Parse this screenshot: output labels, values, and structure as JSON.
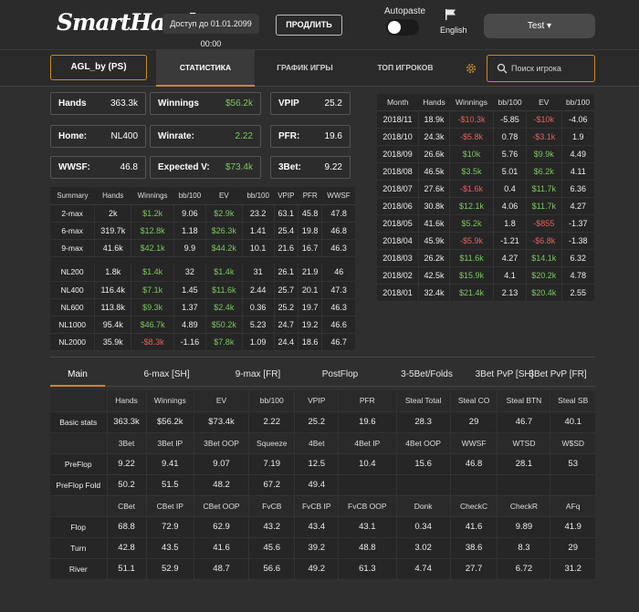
{
  "header": {
    "logo": "SmartHand",
    "access": "Доступ до 01.01.2099 00:00",
    "renew_label": "ПРОДЛИТЬ",
    "autopaste_label": "Autopaste",
    "language": "English",
    "user": "Test ▾"
  },
  "nav": {
    "account": "AGL_by (PS)",
    "tabs": [
      "СТАТИСТИКА",
      "ГРАФИК ИГРЫ",
      "ТОП ИГРОКОВ"
    ],
    "search_placeholder": "Поиск игрока"
  },
  "cards": [
    {
      "label": "Hands",
      "value": "363.3k",
      "green": false
    },
    {
      "label": "Winnings",
      "value": "$56.2k",
      "green": true
    },
    {
      "label": "VPIP",
      "value": "25.2",
      "green": false
    },
    {
      "label": "Home:",
      "value": "NL400",
      "green": false
    },
    {
      "label": "Winrate:",
      "value": "2.22",
      "green": true
    },
    {
      "label": "PFR:",
      "value": "19.6",
      "green": false
    },
    {
      "label": "WWSF:",
      "value": "46.8",
      "green": false
    },
    {
      "label": "Expected V:",
      "value": "$73.4k",
      "green": true
    },
    {
      "label": "3Bet:",
      "value": "9.22",
      "green": false
    }
  ],
  "summary": {
    "headers": [
      "Summary",
      "Hands",
      "Winnings",
      "bb/100",
      "EV",
      "bb/100",
      "VPIP",
      "PFR",
      "WWSF"
    ],
    "groups": [
      [
        [
          "2-max",
          "2k",
          "$1.2k",
          "9.06",
          "$2.9k",
          "23.2",
          "63.1",
          "45.8",
          "47.8"
        ],
        [
          "6-max",
          "319.7k",
          "$12.8k",
          "1.18",
          "$26.3k",
          "1.41",
          "25.4",
          "19.8",
          "46.8"
        ],
        [
          "9-max",
          "41.6k",
          "$42.1k",
          "9.9",
          "$44.2k",
          "10.1",
          "21.6",
          "16.7",
          "46.3"
        ]
      ],
      [
        [
          "NL200",
          "1.8k",
          "$1.4k",
          "32",
          "$1.4k",
          "31",
          "26.1",
          "21.9",
          "46"
        ],
        [
          "NL400",
          "116.4k",
          "$7.1k",
          "1.45",
          "$11.6k",
          "2.44",
          "25.7",
          "20.1",
          "47.3"
        ],
        [
          "NL600",
          "113.8k",
          "$9.3k",
          "1.37",
          "$2.4k",
          "0.36",
          "25.2",
          "19.7",
          "46.3"
        ],
        [
          "NL1000",
          "95.4k",
          "$46.7k",
          "4.89",
          "$50.2k",
          "5.23",
          "24.7",
          "19.2",
          "46.6"
        ],
        [
          "NL2000",
          "35.9k",
          "-$8.3k",
          "-1.16",
          "$7.8k",
          "1.09",
          "24.4",
          "18.6",
          "46.7"
        ]
      ]
    ]
  },
  "months": {
    "headers": [
      "Month",
      "Hands",
      "Winnings",
      "bb/100",
      "EV",
      "bb/100"
    ],
    "rows": [
      [
        "2018/11",
        "18.9k",
        "-$10.3k",
        "-5.85",
        "-$10k",
        "-4.06"
      ],
      [
        "2018/10",
        "24.3k",
        "-$5.8k",
        "0.78",
        "-$3.1k",
        "1.9"
      ],
      [
        "2018/09",
        "26.6k",
        "$10k",
        "5.76",
        "$9.9k",
        "4.49"
      ],
      [
        "2018/08",
        "46.5k",
        "$3.5k",
        "5.01",
        "$6.2k",
        "4.11"
      ],
      [
        "2018/07",
        "27.6k",
        "-$1.6k",
        "0.4",
        "$11.7k",
        "6.36"
      ],
      [
        "2018/06",
        "30.8k",
        "$12.1k",
        "4.06",
        "$11.7k",
        "4.27"
      ],
      [
        "2018/05",
        "41.6k",
        "$5.2k",
        "1.8",
        "-$855",
        "-1.37"
      ],
      [
        "2018/04",
        "45.9k",
        "-$5.9k",
        "-1.21",
        "-$6.8k",
        "-1.38"
      ],
      [
        "2018/03",
        "26.2k",
        "$11.6k",
        "4.27",
        "$14.1k",
        "6.32"
      ],
      [
        "2018/02",
        "42.5k",
        "$15.9k",
        "4.1",
        "$20.2k",
        "4.78"
      ],
      [
        "2018/01",
        "32.4k",
        "$21.4k",
        "2.13",
        "$20.4k",
        "2.55"
      ]
    ]
  },
  "stat_tabs": [
    "Main",
    "6-max [SH]",
    "9-max [FR]",
    "PostFlop",
    "3-5Bet/Folds",
    "3Bet PvP [SH]",
    "3Bet PvP [FR]"
  ],
  "stats": [
    {
      "type": "hdr",
      "cells": [
        "",
        "Hands",
        "Winnings",
        "EV",
        "bb/100",
        "VPIP",
        "PFR",
        "Steal Total",
        "Steal CO",
        "Steal BTN",
        "Steal SB"
      ]
    },
    {
      "type": "row",
      "cells": [
        "Basic stats",
        "363.3k",
        "$56.2k",
        "$73.4k",
        "2.22",
        "25.2",
        "19.6",
        "28.3",
        "29",
        "46.7",
        "40.1"
      ]
    },
    {
      "type": "hdr",
      "cells": [
        "",
        "3Bet",
        "3Bet IP",
        "3Bet OOP",
        "Squeeze",
        "4Bet",
        "4Bet IP",
        "4Bet OOP",
        "WWSF",
        "WTSD",
        "W$SD"
      ]
    },
    {
      "type": "row",
      "cells": [
        "PreFlop",
        "9.22",
        "9.41",
        "9.07",
        "7.19",
        "12.5",
        "10.4",
        "15.6",
        "46.8",
        "28.1",
        "53"
      ]
    },
    {
      "type": "row",
      "cells": [
        "PreFlop Fold",
        "50.2",
        "51.5",
        "48.2",
        "67.2",
        "49.4",
        "",
        "",
        "",
        "",
        ""
      ]
    },
    {
      "type": "hdr",
      "cells": [
        "",
        "CBet",
        "CBet IP",
        "CBet OOP",
        "FvCB",
        "FvCB IP",
        "FvCB OOP",
        "Donk",
        "CheckC",
        "CheckR",
        "AFq"
      ]
    },
    {
      "type": "row",
      "cells": [
        "Flop",
        "68.8",
        "72.9",
        "62.9",
        "43.2",
        "43.4",
        "43.1",
        "0.34",
        "41.6",
        "9.89",
        "41.9"
      ]
    },
    {
      "type": "row",
      "cells": [
        "Turn",
        "42.8",
        "43.5",
        "41.6",
        "45.6",
        "39.2",
        "48.8",
        "3.02",
        "38.6",
        "8.3",
        "29"
      ]
    },
    {
      "type": "row",
      "cells": [
        "River",
        "51.1",
        "52.9",
        "48.7",
        "56.6",
        "49.2",
        "61.3",
        "4.74",
        "27.7",
        "6.72",
        "31.2"
      ]
    }
  ]
}
